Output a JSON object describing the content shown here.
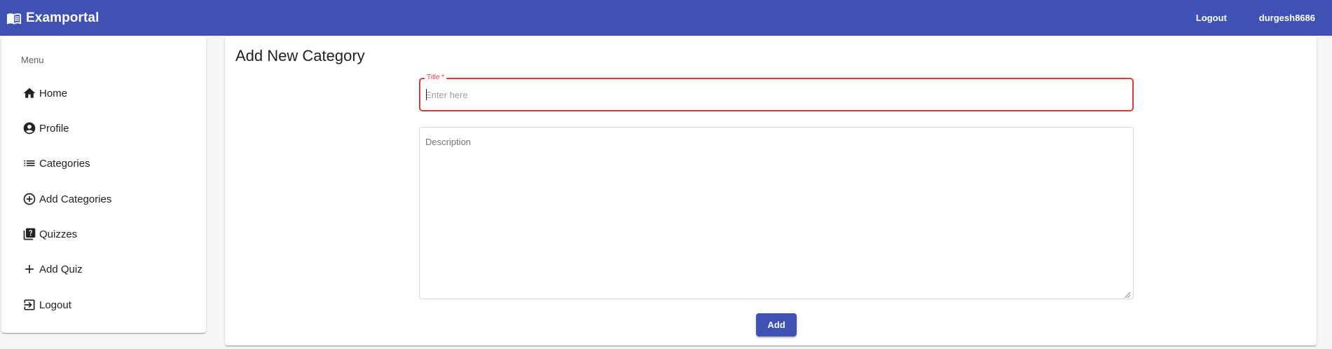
{
  "app": {
    "name": "Examportal",
    "logo_icon": "book-icon",
    "accent_color": "#3f51b5"
  },
  "topbar": {
    "logout_label": "Logout",
    "username": "durgesh8686"
  },
  "sidebar": {
    "menu_title": "Menu",
    "items": [
      {
        "label": "Home",
        "icon": "home-icon"
      },
      {
        "label": "Profile",
        "icon": "account-circle-icon"
      },
      {
        "label": "Categories",
        "icon": "list-icon"
      },
      {
        "label": "Add Categories",
        "icon": "add-circle-icon"
      },
      {
        "label": "Quizzes",
        "icon": "quiz-icon"
      },
      {
        "label": "Add Quiz",
        "icon": "plus-icon"
      },
      {
        "label": "Logout",
        "icon": "logout-icon"
      }
    ]
  },
  "form": {
    "page_title": "Add New Category",
    "title_field": {
      "label": "Title *",
      "placeholder": "Enter here",
      "value": "",
      "error_color": "#e53935"
    },
    "description_field": {
      "placeholder": "Description",
      "value": ""
    },
    "submit_label": "Add"
  }
}
